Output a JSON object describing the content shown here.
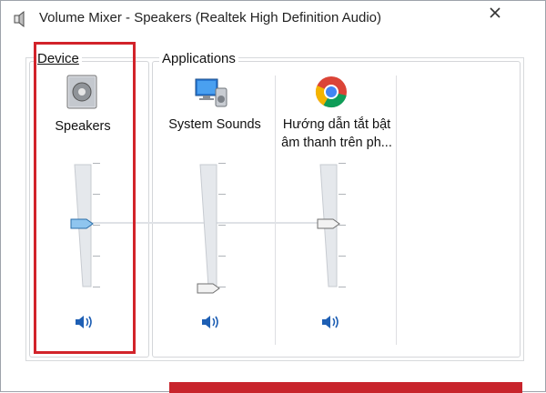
{
  "window": {
    "title": "Volume Mixer - Speakers (Realtek High Definition Audio)"
  },
  "device_group": {
    "label": "Device",
    "items": [
      {
        "name": "Speakers",
        "icon": "speaker-device-icon",
        "volume_percent": 45,
        "muted": false
      }
    ]
  },
  "applications_group": {
    "label": "Applications",
    "items": [
      {
        "name": "System Sounds",
        "icon": "system-sounds-icon",
        "volume_percent": 0,
        "muted": false
      },
      {
        "name_line1": "Hướng dẫn tắt bật",
        "name_line2": "âm thanh trên ph...",
        "icon": "chrome-icon",
        "volume_percent": 45,
        "muted": false
      }
    ]
  },
  "colors": {
    "highlight": "#d2232a",
    "accent_blue": "#1e5fb4",
    "bottom_band": "#c8242c"
  }
}
